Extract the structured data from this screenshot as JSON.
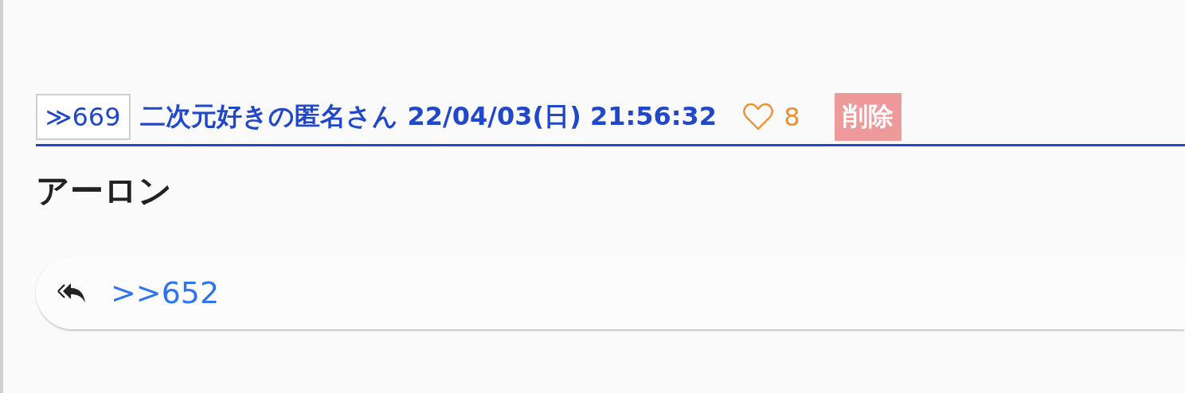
{
  "post": {
    "number": "≫669",
    "author": "二次元好きの匿名さん",
    "datetime": "22/04/03(日) 21:56:32",
    "likes": "8",
    "delete_label": "削除",
    "body": "アーロン",
    "replies": [
      ">>652"
    ]
  }
}
